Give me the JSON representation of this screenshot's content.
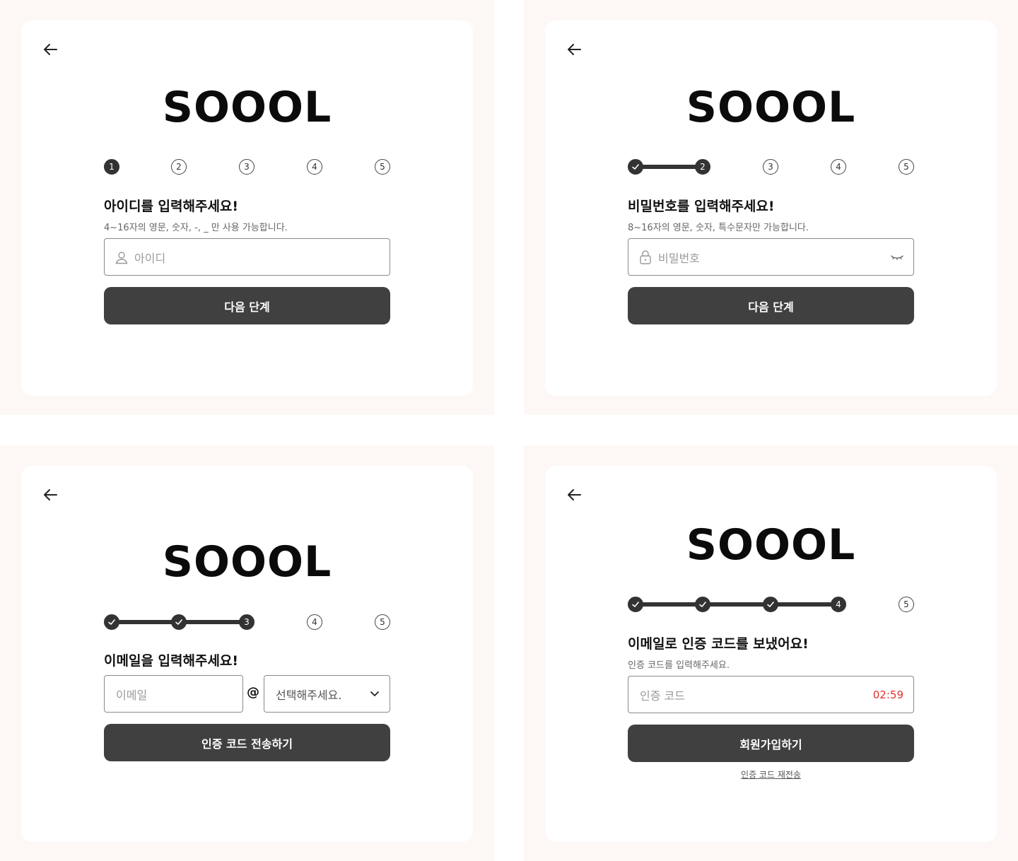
{
  "brand": {
    "logo_text": "SOOOL"
  },
  "panel1": {
    "steps": [
      "1",
      "2",
      "3",
      "4",
      "5"
    ],
    "heading": "아이디를 입력해주세요!",
    "sub": "4~16자의 영문, 숫자, -, _ 만 사용 가능합니다.",
    "input_placeholder": "아이디",
    "button": "다음 단계"
  },
  "panel2": {
    "steps": [
      "",
      "2",
      "3",
      "4",
      "5"
    ],
    "heading": "비밀번호를 입력해주세요!",
    "sub": "8~16자의 영문, 숫자, 특수문자만 가능합니다.",
    "input_placeholder": "비밀번호",
    "button": "다음 단계"
  },
  "panel3": {
    "steps": [
      "",
      "",
      "3",
      "4",
      "5"
    ],
    "heading": "이메일을 입력해주세요!",
    "email_placeholder": "이메일",
    "at": "@",
    "domain_select": "선택해주세요.",
    "button": "인증 코드 전송하기"
  },
  "panel4": {
    "steps": [
      "",
      "",
      "",
      "4",
      "5"
    ],
    "heading": "이메일로 인증 코드를 보냈어요!",
    "sub": "인증 코드를 입력해주세요.",
    "input_placeholder": "인증 코드",
    "timer": "02:59",
    "button": "회원가입하기",
    "resend": "인증 코드 재전송"
  },
  "colors": {
    "panel_bg": "#fdf8f6",
    "card_bg": "#ffffff",
    "button_bg": "#404040",
    "timer": "#e0302f"
  },
  "icons": {
    "back": "arrow-left-icon",
    "user": "user-icon",
    "lock": "lock-icon",
    "eye": "eye-closed-icon",
    "check": "check-icon",
    "dropdown": "chevron-down-icon"
  }
}
